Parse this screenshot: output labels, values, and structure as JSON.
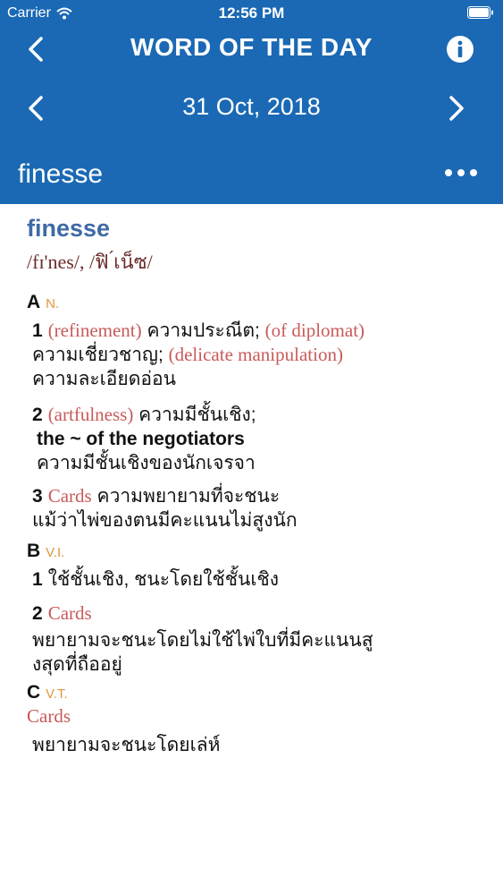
{
  "status": {
    "carrier": "Carrier",
    "time": "12:56 PM"
  },
  "nav": {
    "title": "WORD OF THE DAY"
  },
  "date_nav": {
    "date": "31 Oct, 2018"
  },
  "word_bar": {
    "word": "finesse"
  },
  "entry": {
    "headword": "finesse",
    "pronunciation": "/fɪ'nes/, /ฟิ ́เน็ซ/",
    "sections": {
      "a": {
        "letter": "A",
        "pos": "N."
      },
      "b": {
        "letter": "B",
        "pos": "V.I."
      },
      "c": {
        "letter": "C",
        "pos": "V.T."
      }
    },
    "a1": {
      "num": "1",
      "g1": "(refinement)",
      "t1": " ความประณีต; ",
      "g2": "(of diplomat)",
      "t2": "ความเชี่ยวชาญ; ",
      "g3": "(delicate manipulation)",
      "t3": "ความละเอียดอ่อน"
    },
    "a2": {
      "num": "2",
      "g1": "(artfulness)",
      "t1": " ความมีชั้นเชิง;",
      "phrase": "the ~ of the negotiators",
      "t2": "ความมีชั้นเชิงของนักเจรจา"
    },
    "a3": {
      "num": "3",
      "g1": "Cards",
      "t1": " ความพยายามที่จะชนะ",
      "t2": "แม้ว่าไพ่ของตนมีคะแนนไม่สูงนัก"
    },
    "b1": {
      "num": "1",
      "t1": "ใช้ชั้นเชิง, ชนะโดยใช้ชั้นเชิง"
    },
    "b2": {
      "num": "2",
      "g1": "Cards",
      "t1": "พยายามจะชนะโดยไม่ใช้ไพ่ใบที่มีคะแนนสู",
      "t2": "งสุดที่ถืออยู่"
    },
    "c1": {
      "g1": "Cards",
      "t1": "พยายามจะชนะโดยเล่ห์"
    }
  }
}
